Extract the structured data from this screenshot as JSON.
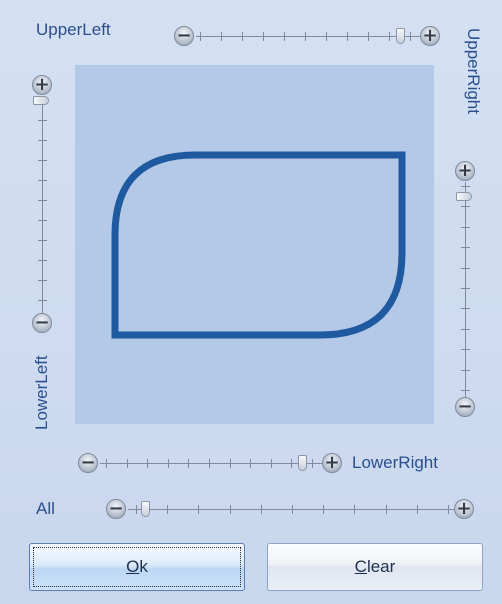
{
  "labels": {
    "upper_left": "UpperLeft",
    "upper_right": "UpperRight",
    "lower_left": "LowerLeft",
    "lower_right": "LowerRight",
    "all": "All"
  },
  "sliders": {
    "upper_left": {
      "value_fraction": 0.95,
      "ticks": 10
    },
    "upper_right": {
      "value_fraction": 0.95,
      "ticks": 10
    },
    "lower_left": {
      "value_fraction": 0.0,
      "ticks": 10
    },
    "lower_right": {
      "value_fraction": 0.95,
      "ticks": 10
    },
    "all": {
      "value_fraction": 0.03,
      "ticks": 10
    }
  },
  "buttons": {
    "minus_glyph": "−",
    "plus_glyph": "+",
    "ok": {
      "mnemonic": "O",
      "rest": "k"
    },
    "clear": {
      "mnemonic": "C",
      "rest": "lear"
    }
  },
  "colors": {
    "preview_background": "#b4c8e8",
    "shape_stroke": "#1f5aa0",
    "label_text": "#2b4f8e"
  }
}
